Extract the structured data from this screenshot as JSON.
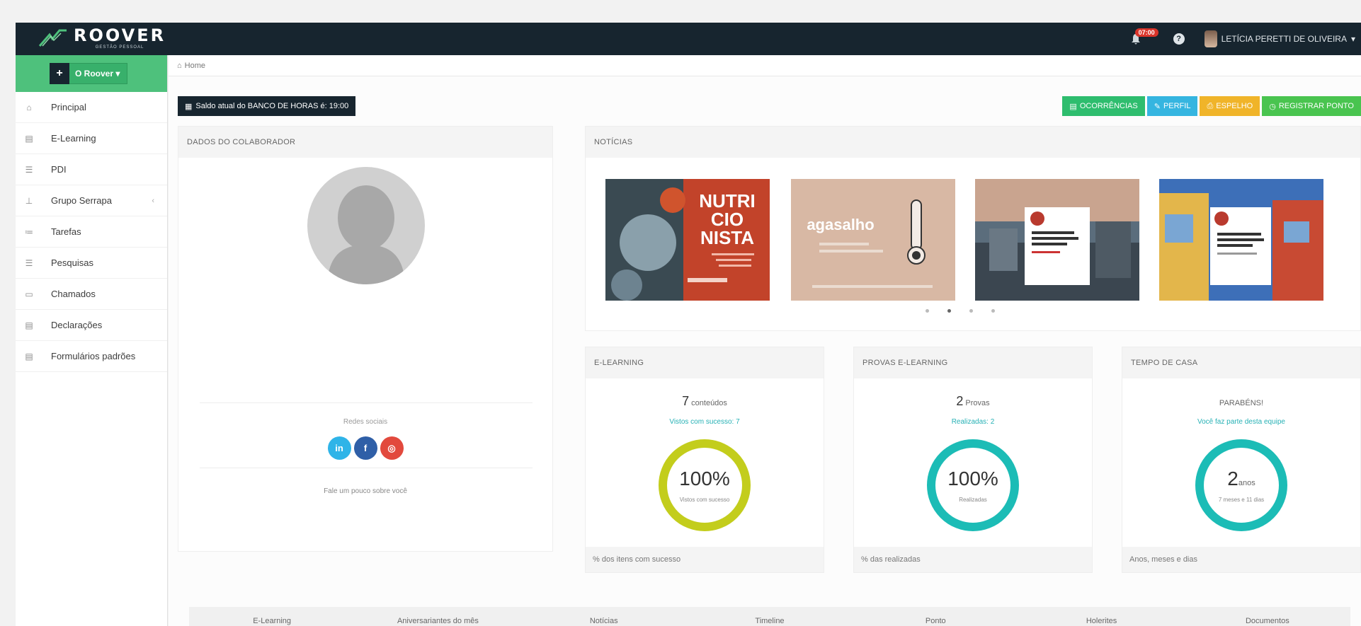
{
  "brand": {
    "name": "ROOVER",
    "tagline": "GESTÃO PESSOAL"
  },
  "header": {
    "notification_badge": "07:00",
    "help_icon": "question-circle-icon",
    "user_name": "LETÍCIA PERETTI DE OLIVEIRA"
  },
  "sidebar": {
    "roover_button": "O Roover",
    "items": [
      {
        "label": "Principal",
        "icon": "home-icon"
      },
      {
        "label": "E-Learning",
        "icon": "document-icon"
      },
      {
        "label": "PDI",
        "icon": "list-icon"
      },
      {
        "label": "Grupo Serrapa",
        "icon": "tree-icon"
      },
      {
        "label": "Tarefas",
        "icon": "tasks-icon"
      },
      {
        "label": "Pesquisas",
        "icon": "list-icon"
      },
      {
        "label": "Chamados",
        "icon": "monitor-icon"
      },
      {
        "label": "Declarações",
        "icon": "document-icon"
      },
      {
        "label": "Formulários padrões",
        "icon": "document-icon"
      }
    ]
  },
  "breadcrumb": {
    "home": "Home"
  },
  "saldo_button": "Saldo atual do BANCO DE HORAS é: 19:00",
  "actions": [
    {
      "label": "OCORRÊNCIAS",
      "color": "#2ebd6e"
    },
    {
      "label": "PERFIL",
      "color": "#35b5e0"
    },
    {
      "label": "ESPELHO",
      "color": "#f0b429"
    },
    {
      "label": "REGISTRAR PONTO",
      "color": "#49c44f"
    }
  ],
  "colaborador": {
    "title": "DADOS DO COLABORADOR",
    "social_label": "Redes sociais",
    "note": "Fale um pouco sobre você"
  },
  "noticias": {
    "title": "NOTÍCIAS",
    "cards": [
      {
        "headline": "NUTRI CIO NISTA",
        "color": "#c2432a"
      },
      {
        "headline": "agasalho",
        "color": "#d8b8a4"
      },
      {
        "headline": "",
        "color": "#5b6d7c"
      },
      {
        "headline": "",
        "color": "#3d6fb8"
      }
    ]
  },
  "stats": [
    {
      "title": "E-LEARNING",
      "count": "7",
      "count_label": "conteúdos",
      "sub": "Vistos com sucesso: 7",
      "ring_value": "100%",
      "ring_unit": "",
      "ring_label": "Vistos com sucesso",
      "progress": 1.0,
      "ring_color": "#c3cd1c",
      "footer": "% dos itens com sucesso"
    },
    {
      "title": "PROVAS E-LEARNING",
      "count": "2",
      "count_label": "Provas",
      "sub": "Realizadas: 2",
      "ring_value": "100%",
      "ring_unit": "",
      "ring_label": "Realizadas",
      "progress": 1.0,
      "ring_color": "#1cbcb6",
      "footer": "% das realizadas"
    },
    {
      "title": "TEMPO DE CASA",
      "count": "",
      "count_label": "PARABÉNS!",
      "sub": "Você faz parte desta equipe",
      "ring_value": "2",
      "ring_unit": "anos",
      "ring_label": "7 meses e 11 dias",
      "progress": 1.0,
      "ring_color": "#1cbcb6",
      "footer": "Anos, meses e dias"
    }
  ],
  "tabs": [
    {
      "label": "E-Learning"
    },
    {
      "label": "Aniversariantes do mês"
    },
    {
      "label": "Notícias"
    },
    {
      "label": "Timeline"
    },
    {
      "label": "Ponto"
    },
    {
      "label": "Holerites"
    },
    {
      "label": "Documentos"
    }
  ],
  "active_tab": "Ponto"
}
